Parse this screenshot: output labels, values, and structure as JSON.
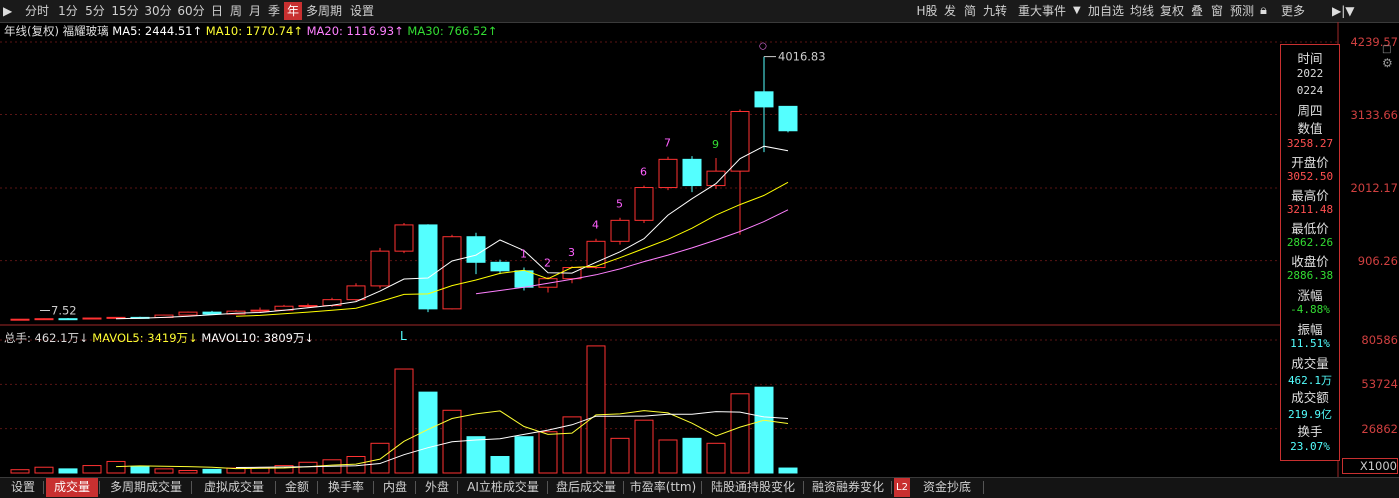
{
  "toolbar": {
    "left": [
      "分时",
      "1分",
      "5分",
      "15分",
      "30分",
      "60分",
      "日",
      "周",
      "月",
      "季",
      "年",
      "多周期",
      "设置"
    ],
    "right": [
      "H股",
      "发",
      "简",
      "九转",
      "重大事件",
      "加自选",
      "均线",
      "复权",
      "叠",
      "窗",
      "预测",
      "更多"
    ]
  },
  "price_legend": {
    "title": "年线(复权)",
    "stock": "福耀玻璃",
    "ma5_label": "MA5: 2444.51↑",
    "ma10_label": "MA10: 1770.74↑",
    "ma20_label": "MA20: 1116.93↑",
    "ma30_label": "MA30: 766.52↑"
  },
  "vol_legend": {
    "total": "总手: 462.1万↓",
    "mavol5": "MAVOL5: 3419万↓",
    "mavol10": "MAVOL10: 3809万↓"
  },
  "price_axis": [
    "4239.57",
    "3133.66",
    "2012.17",
    "906.26"
  ],
  "vol_axis": [
    "80586",
    "53724",
    "26862",
    "X1000"
  ],
  "annotations": {
    "high": "4016.83",
    "low": "7.52",
    "low_marker": "L",
    "high_marker": "○",
    "td_counts": [
      "1",
      "2",
      "3",
      "4",
      "5",
      "6",
      "7",
      "9"
    ]
  },
  "panel": {
    "time_label": "时间",
    "year": "2022",
    "date": "0224",
    "weekday": "周四",
    "value_label": "数值",
    "value": "3258.27",
    "open_label": "开盘价",
    "open": "3052.50",
    "high_label": "最高价",
    "high": "3211.48",
    "low_label": "最低价",
    "low": "2862.26",
    "close_label": "收盘价",
    "close": "2886.38",
    "change_label": "涨幅",
    "change": "-4.88%",
    "amp_label": "振幅",
    "amp": "11.51%",
    "vol_label": "成交量",
    "vol": "462.1万",
    "amount_label": "成交额",
    "amount": "219.9亿",
    "turnover_label": "换手",
    "turnover": "23.07%"
  },
  "bottom_tabs": [
    "设置",
    "成交量",
    "多周期成交量",
    "虚拟成交量",
    "金额",
    "换手率",
    "内盘",
    "外盘",
    "AI立桩成交量",
    "盘后成交量",
    "市盈率(ttm)",
    "陆股通持股变化",
    "融资融券变化",
    "资金抄底"
  ],
  "bottom_badge": "L2",
  "colors": {
    "up": "#ff3232",
    "down": "#54ffff",
    "ma5": "#ffffff",
    "ma10": "#ffff00",
    "ma20": "#ff80ff",
    "ma30": "#00e000"
  },
  "chart_data": {
    "type": "candlestick",
    "candles": [
      {
        "open": 9,
        "close": 12,
        "high": 14,
        "low": 7.52
      },
      {
        "open": 12,
        "close": 20,
        "high": 25,
        "low": 10
      },
      {
        "open": 20,
        "close": 18,
        "high": 30,
        "low": 15
      },
      {
        "open": 18,
        "close": 30,
        "high": 35,
        "low": 15
      },
      {
        "open": 30,
        "close": 40,
        "high": 45,
        "low": 25
      },
      {
        "open": 40,
        "close": 38,
        "high": 50,
        "low": 30
      },
      {
        "open": 38,
        "close": 75,
        "high": 80,
        "low": 35
      },
      {
        "open": 75,
        "close": 120,
        "high": 130,
        "low": 70
      },
      {
        "open": 120,
        "close": 90,
        "high": 140,
        "low": 80
      },
      {
        "open": 90,
        "close": 135,
        "high": 150,
        "low": 85
      },
      {
        "open": 135,
        "close": 150,
        "high": 190,
        "low": 120
      },
      {
        "open": 150,
        "close": 210,
        "high": 230,
        "low": 140
      },
      {
        "open": 210,
        "close": 220,
        "high": 250,
        "low": 190
      },
      {
        "open": 220,
        "close": 310,
        "high": 340,
        "low": 200
      },
      {
        "open": 310,
        "close": 520,
        "high": 560,
        "low": 290
      },
      {
        "open": 520,
        "close": 1050,
        "high": 1100,
        "low": 480
      },
      {
        "open": 1050,
        "close": 1450,
        "high": 1480,
        "low": 1020
      },
      {
        "open": 1450,
        "close": 170,
        "high": 1460,
        "low": 120
      },
      {
        "open": 170,
        "close": 1270,
        "high": 1300,
        "low": 160
      },
      {
        "open": 1270,
        "close": 880,
        "high": 1330,
        "low": 700
      },
      {
        "open": 880,
        "close": 750,
        "high": 920,
        "low": 700
      },
      {
        "open": 750,
        "close": 500,
        "high": 800,
        "low": 450
      },
      {
        "open": 500,
        "close": 630,
        "high": 660,
        "low": 420
      },
      {
        "open": 630,
        "close": 800,
        "high": 820,
        "low": 560
      },
      {
        "open": 800,
        "close": 1200,
        "high": 1240,
        "low": 780
      },
      {
        "open": 1200,
        "close": 1520,
        "high": 1560,
        "low": 1150
      },
      {
        "open": 1520,
        "close": 2020,
        "high": 2050,
        "low": 1480
      },
      {
        "open": 2020,
        "close": 2450,
        "high": 2490,
        "low": 1980
      },
      {
        "open": 2450,
        "close": 2050,
        "high": 2500,
        "low": 1950
      },
      {
        "open": 2050,
        "close": 2270,
        "high": 2470,
        "low": 2000
      },
      {
        "open": 2270,
        "close": 3180,
        "high": 3210,
        "low": 1300
      },
      {
        "open": 3480,
        "close": 3250,
        "high": 4016.83,
        "low": 2560
      },
      {
        "open": 3258,
        "close": 2886,
        "high": 3211,
        "low": 2862
      }
    ],
    "ma5": [
      null,
      null,
      null,
      null,
      20,
      27,
      39,
      58,
      80,
      103,
      114,
      149,
      186,
      225,
      281,
      440,
      626,
      640,
      900,
      990,
      1220,
      1060,
      720,
      715,
      880,
      1040,
      1240,
      1600,
      1850,
      2080,
      2460,
      2650,
      2580
    ],
    "ma10": [
      null,
      null,
      null,
      null,
      null,
      null,
      null,
      null,
      null,
      58,
      70,
      94,
      120,
      148,
      180,
      280,
      390,
      398,
      525,
      610,
      710,
      760,
      630,
      800,
      820,
      950,
      1090,
      1230,
      1400,
      1600,
      1760,
      1900,
      2100
    ],
    "ma20": [
      null,
      null,
      null,
      null,
      null,
      null,
      null,
      null,
      null,
      null,
      null,
      null,
      null,
      null,
      null,
      null,
      null,
      null,
      null,
      400,
      450,
      500,
      560,
      620,
      690,
      780,
      890,
      990,
      1100,
      1220,
      1350,
      1500,
      1680
    ],
    "ma30": [],
    "volume": [
      2000,
      3500,
      2500,
      4500,
      7000,
      4000,
      2500,
      1500,
      2200,
      3000,
      3000,
      4500,
      6500,
      8000,
      10000,
      18000,
      63000,
      49000,
      38000,
      22000,
      10000,
      22000,
      25000,
      34000,
      77000,
      21000,
      32000,
      20000,
      21000,
      18000,
      48000,
      52000,
      3000
    ],
    "mavol5": [
      null,
      null,
      null,
      null,
      3900,
      4300,
      4100,
      3900,
      3440,
      2640,
      2840,
      3040,
      3840,
      4800,
      5400,
      8400,
      19200,
      26400,
      33000,
      35800,
      37600,
      28200,
      23400,
      24200,
      35200,
      35800,
      37800,
      36400,
      30200,
      22400,
      27800,
      32000,
      30000
    ],
    "mavol10": [
      null,
      null,
      null,
      null,
      null,
      null,
      null,
      null,
      null,
      3360,
      3460,
      3620,
      3780,
      4060,
      4360,
      5740,
      11080,
      15340,
      18900,
      20000,
      20800,
      23400,
      26000,
      29200,
      34400,
      34400,
      34500,
      35600,
      35600,
      37200,
      36900,
      34000,
      33000
    ],
    "price_ylim": [
      0,
      4239.57
    ],
    "vol_ylim": [
      0,
      80586
    ]
  }
}
